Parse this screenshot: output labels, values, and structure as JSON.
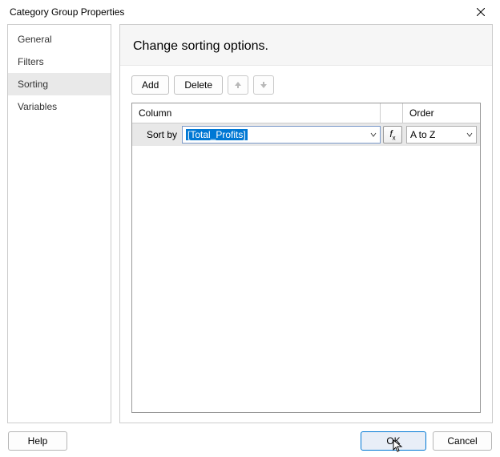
{
  "title": "Category Group Properties",
  "nav": {
    "items": [
      "General",
      "Filters",
      "Sorting",
      "Variables"
    ],
    "selected": 2
  },
  "main": {
    "heading": "Change sorting options."
  },
  "toolbar": {
    "add": "Add",
    "delete": "Delete"
  },
  "grid": {
    "headers": {
      "column": "Column",
      "order": "Order"
    },
    "row": {
      "label": "Sort by",
      "column_value": "[Total_Profits]",
      "order_value": "A to Z"
    }
  },
  "footer": {
    "help": "Help",
    "ok": "OK",
    "cancel": "Cancel"
  }
}
